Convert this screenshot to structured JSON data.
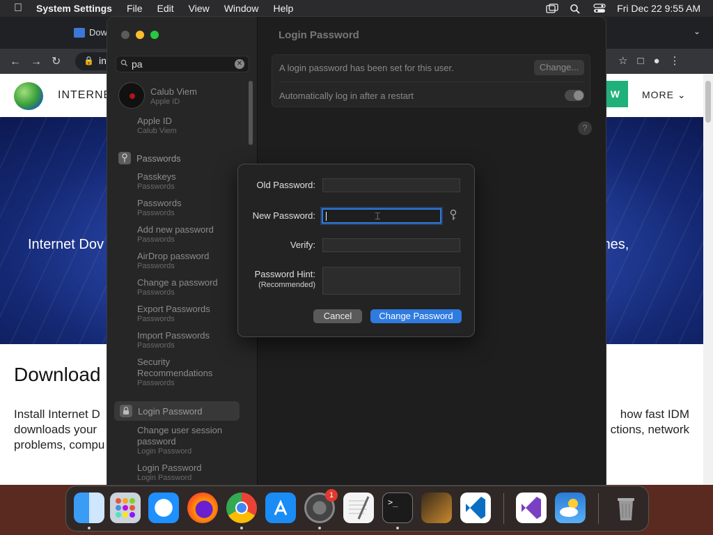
{
  "menubar": {
    "app_name": "System Settings",
    "menus": [
      "File",
      "Edit",
      "View",
      "Window",
      "Help"
    ],
    "datetime": "Fri Dec 22  9:55 AM"
  },
  "browser": {
    "tab_title": "Dow",
    "address_fragment": "in",
    "brand": "INTERNET",
    "cta_fragment": "W",
    "more_label": "MORE",
    "hero_left": "Internet Dov",
    "hero_right": "mes,",
    "heading_fragment": "Download",
    "para_line1_left": "Install Internet D",
    "para_line1_right": "how fast IDM",
    "para_line2_left": "downloads your",
    "para_line2_right": "ctions, network",
    "para_line3_left": "problems, compu"
  },
  "search": {
    "value": "pa",
    "clear_icon": "clear-icon"
  },
  "sidebar": {
    "user": {
      "name": "Calub Viem",
      "sub": "Apple ID"
    },
    "items": [
      {
        "label": "Apple ID",
        "sub": "Calub Viem"
      },
      {
        "label": "Passwords",
        "type": "section"
      },
      {
        "label": "Passkeys",
        "sub": "Passwords"
      },
      {
        "label": "Passwords",
        "sub": "Passwords"
      },
      {
        "label": "Add new password",
        "sub": "Passwords"
      },
      {
        "label": "AirDrop password",
        "sub": "Passwords"
      },
      {
        "label": "Change a password",
        "sub": "Passwords"
      },
      {
        "label": "Export Passwords",
        "sub": "Passwords"
      },
      {
        "label": "Import Passwords",
        "sub": "Passwords"
      },
      {
        "label": "Security Recommendations",
        "sub": "Passwords"
      },
      {
        "label": "Login Password",
        "type": "section-selected"
      },
      {
        "label": "Change user session password",
        "sub": "Login Password"
      },
      {
        "label": "Login Password",
        "sub": "Login Password"
      }
    ]
  },
  "main": {
    "title": "Login Password",
    "row1": "A login password has been set for this user.",
    "change_button": "Change...",
    "row2": "Automatically log in after a restart",
    "help": "?"
  },
  "dialog": {
    "old_password_label": "Old Password:",
    "new_password_label": "New Password:",
    "verify_label": "Verify:",
    "hint_label": "Password Hint:",
    "hint_sub": "(Recommended)",
    "old_password_value": "",
    "new_password_value": "",
    "verify_value": "",
    "hint_value": "",
    "cancel_label": "Cancel",
    "change_label": "Change Password"
  },
  "dock": {
    "apps": [
      "Finder",
      "Launchpad",
      "Safari",
      "Firefox",
      "Chrome",
      "App Store",
      "System Settings",
      "TextEdit",
      "Terminal",
      "GarageBand",
      "VS Code",
      "Visual Studio",
      "Weather",
      "Trash"
    ],
    "settings_badge": "1"
  }
}
